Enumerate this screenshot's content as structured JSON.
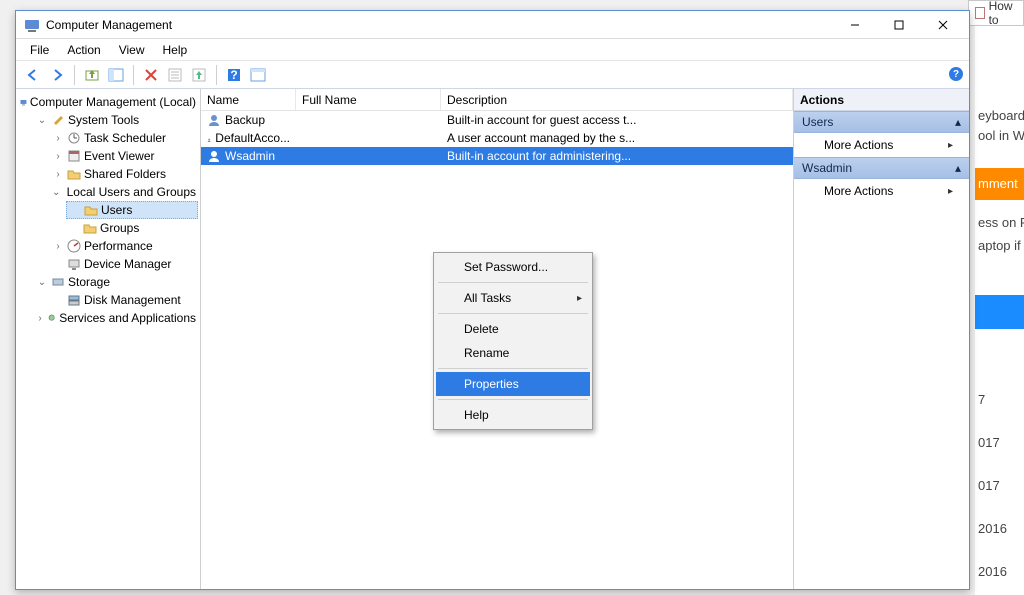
{
  "bg": {
    "tab_label": "How to",
    "lines": [
      "eyboard",
      "ool in W",
      "mment",
      "ess on F",
      "aptop if",
      "7",
      "017",
      "017",
      "2016",
      "2016"
    ]
  },
  "window": {
    "title": "Computer Management",
    "menus": [
      "File",
      "Action",
      "View",
      "Help"
    ]
  },
  "toolbar": {
    "buttons": [
      "back",
      "forward",
      "up",
      "properties-window",
      "delete",
      "open",
      "export",
      "column-config",
      "help",
      "refresh-view"
    ]
  },
  "tree": {
    "root": "Computer Management (Local)",
    "system_tools": "System Tools",
    "task_scheduler": "Task Scheduler",
    "event_viewer": "Event Viewer",
    "shared_folders": "Shared Folders",
    "local_users_groups": "Local Users and Groups",
    "users": "Users",
    "groups": "Groups",
    "performance": "Performance",
    "device_manager": "Device Manager",
    "storage": "Storage",
    "disk_management": "Disk Management",
    "services_apps": "Services and Applications"
  },
  "list": {
    "headers": {
      "name": "Name",
      "full_name": "Full Name",
      "description": "Description"
    },
    "rows": [
      {
        "name": "Backup",
        "full_name": "",
        "description": "Built-in account for guest access t..."
      },
      {
        "name": "DefaultAcco...",
        "full_name": "",
        "description": "A user account managed by the s..."
      },
      {
        "name": "Wsadmin",
        "full_name": "",
        "description": "Built-in account for administering...",
        "selected": true
      }
    ]
  },
  "context_menu": {
    "set_password": "Set Password...",
    "all_tasks": "All Tasks",
    "delete": "Delete",
    "rename": "Rename",
    "properties": "Properties",
    "help": "Help"
  },
  "actions": {
    "title": "Actions",
    "group1": "Users",
    "more1": "More Actions",
    "group2": "Wsadmin",
    "more2": "More Actions"
  }
}
